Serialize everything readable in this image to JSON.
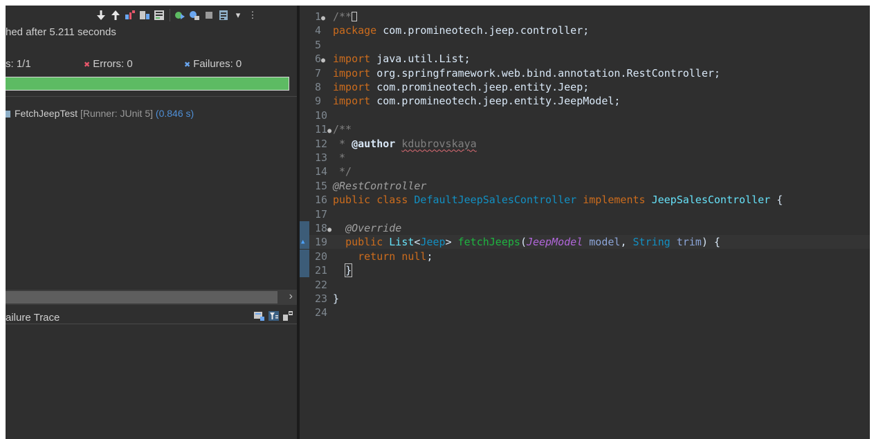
{
  "junit": {
    "toolbar_icons": [
      "next-failure-icon",
      "previous-failure-icon",
      "failures-only-icon",
      "skipped-only-icon",
      "scroll-lock-icon",
      "rerun-test-icon",
      "rerun-failed-icon",
      "stop-icon",
      "history-icon",
      "view-menu-icon",
      "more-icon"
    ],
    "finished_text": "hed after 5.211 seconds",
    "runs_text": "s:  1/1",
    "errors_text": "Errors:  0",
    "failures_text": "Failures:  0",
    "progress_status": "passed",
    "progress": 1.0,
    "progress_color": "#5dbb63",
    "test_item": {
      "name": "FetchJeepTest",
      "runner": "[Runner: JUnit 5]",
      "time": "(0.846 s)"
    },
    "failure_trace_title": "ailure Trace"
  },
  "editor": {
    "lines": [
      {
        "n": "1",
        "fold": true,
        "segments": [
          {
            "c": "cm",
            "t": "/**"
          }
        ],
        "box": true
      },
      {
        "n": "4",
        "segments": [
          {
            "c": "kw",
            "t": "package"
          },
          {
            "c": "pl",
            "t": " com.promineotech.jeep.controller;"
          }
        ]
      },
      {
        "n": "5",
        "segments": []
      },
      {
        "n": "6",
        "fold": true,
        "segments": [
          {
            "c": "kw",
            "t": "import"
          },
          {
            "c": "pl",
            "t": " java.util.List;"
          }
        ]
      },
      {
        "n": "7",
        "segments": [
          {
            "c": "kw",
            "t": "import"
          },
          {
            "c": "pl",
            "t": " org.springframework.web.bind.annotation.RestController;"
          }
        ]
      },
      {
        "n": "8",
        "segments": [
          {
            "c": "kw",
            "t": "import"
          },
          {
            "c": "pl",
            "t": " com.promineotech.jeep.entity.Jeep;"
          }
        ]
      },
      {
        "n": "9",
        "segments": [
          {
            "c": "kw",
            "t": "import"
          },
          {
            "c": "pl",
            "t": " com.promineotech.jeep.entity.JeepModel;"
          }
        ]
      },
      {
        "n": "10",
        "segments": []
      },
      {
        "n": "11",
        "fold": true,
        "segments": [
          {
            "c": "jd",
            "t": "/**"
          }
        ]
      },
      {
        "n": "12",
        "segments": [
          {
            "c": "jd",
            "t": " * "
          },
          {
            "c": "tag",
            "t": "@author"
          },
          {
            "c": "jd",
            "t": " "
          },
          {
            "c": "jd squig",
            "t": "kdubrovskaya"
          }
        ]
      },
      {
        "n": "13",
        "segments": [
          {
            "c": "jd",
            "t": " *"
          }
        ]
      },
      {
        "n": "14",
        "segments": [
          {
            "c": "jd",
            "t": " */"
          }
        ]
      },
      {
        "n": "15",
        "segments": [
          {
            "c": "ann",
            "t": "@RestController"
          }
        ]
      },
      {
        "n": "16",
        "segments": [
          {
            "c": "kw",
            "t": "public"
          },
          {
            "c": "pl",
            "t": " "
          },
          {
            "c": "kw",
            "t": "class"
          },
          {
            "c": "pl",
            "t": " "
          },
          {
            "c": "cls",
            "t": "DefaultJeepSalesController"
          },
          {
            "c": "pl",
            "t": " "
          },
          {
            "c": "kw",
            "t": "implements"
          },
          {
            "c": "pl",
            "t": " "
          },
          {
            "c": "cls2",
            "t": "JeepSalesController"
          },
          {
            "c": "pl",
            "t": " {"
          }
        ]
      },
      {
        "n": "17",
        "segments": []
      },
      {
        "n": "18",
        "fold": true,
        "marker": true,
        "segments": [
          {
            "c": "pl",
            "t": "  "
          },
          {
            "c": "ann",
            "t": "@Override"
          }
        ]
      },
      {
        "n": "19",
        "marker": true,
        "caret": true,
        "current": true,
        "segments": [
          {
            "c": "pl",
            "t": "  "
          },
          {
            "c": "kw",
            "t": "public"
          },
          {
            "c": "pl",
            "t": " "
          },
          {
            "c": "cls2",
            "t": "List"
          },
          {
            "c": "pl",
            "t": "<"
          },
          {
            "c": "cls",
            "t": "Jeep"
          },
          {
            "c": "pl",
            "t": "> "
          },
          {
            "c": "meth",
            "t": "fetchJeeps"
          },
          {
            "c": "pl",
            "t": "("
          },
          {
            "c": "itype",
            "t": "JeepModel"
          },
          {
            "c": "pl",
            "t": " "
          },
          {
            "c": "param",
            "t": "model"
          },
          {
            "c": "pl",
            "t": ", "
          },
          {
            "c": "cls",
            "t": "String"
          },
          {
            "c": "pl",
            "t": " "
          },
          {
            "c": "param",
            "t": "trim"
          },
          {
            "c": "pl",
            "t": ") {"
          }
        ]
      },
      {
        "n": "20",
        "marker": true,
        "segments": [
          {
            "c": "pl",
            "t": "    "
          },
          {
            "c": "kw",
            "t": "return"
          },
          {
            "c": "pl",
            "t": " "
          },
          {
            "c": "kw",
            "t": "null"
          },
          {
            "c": "pl",
            "t": ";"
          }
        ]
      },
      {
        "n": "21",
        "marker": true,
        "segments": [
          {
            "c": "pl",
            "t": "  "
          },
          {
            "c": "pl bracket-box",
            "t": "}"
          }
        ]
      },
      {
        "n": "22",
        "segments": []
      },
      {
        "n": "23",
        "segments": [
          {
            "c": "pl",
            "t": "}"
          }
        ]
      },
      {
        "n": "24",
        "segments": []
      }
    ]
  }
}
